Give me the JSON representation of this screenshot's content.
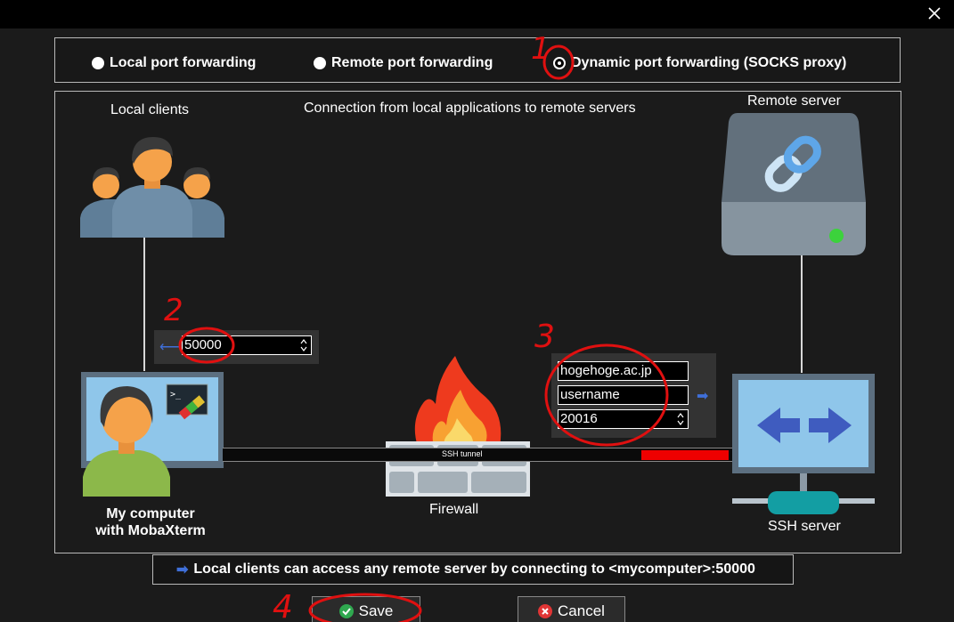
{
  "window": {
    "close_label": "✕"
  },
  "radios": {
    "local": "Local port forwarding",
    "remote": "Remote port forwarding",
    "dynamic": "Dynamic port forwarding (SOCKS proxy)",
    "selected": "dynamic"
  },
  "diagram": {
    "local_clients": "Local clients",
    "caption": "Connection from local applications to remote servers",
    "remote_server": "Remote server",
    "my_computer_line1": "My computer",
    "my_computer_line2": "with MobaXterm",
    "firewall": "Firewall",
    "ssh_tunnel": "SSH tunnel",
    "ssh_server": "SSH server"
  },
  "fields": {
    "local_port": "50000",
    "ssh_host": "hogehoge.ac.jp",
    "ssh_user": "username",
    "ssh_port": "20016"
  },
  "info": {
    "arrow": "➡",
    "text": "Local clients can access any remote server by connecting to <mycomputer>:50000"
  },
  "buttons": {
    "save": "Save",
    "cancel": "Cancel"
  },
  "annotations": {
    "n1": "1",
    "n2": "2",
    "n3": "3",
    "n4": "4"
  },
  "colors": {
    "accent_blue": "#3f6fd9",
    "annotation_red": "#e01010",
    "tunnel_red": "#e00000",
    "status_green": "#3cd23c"
  }
}
